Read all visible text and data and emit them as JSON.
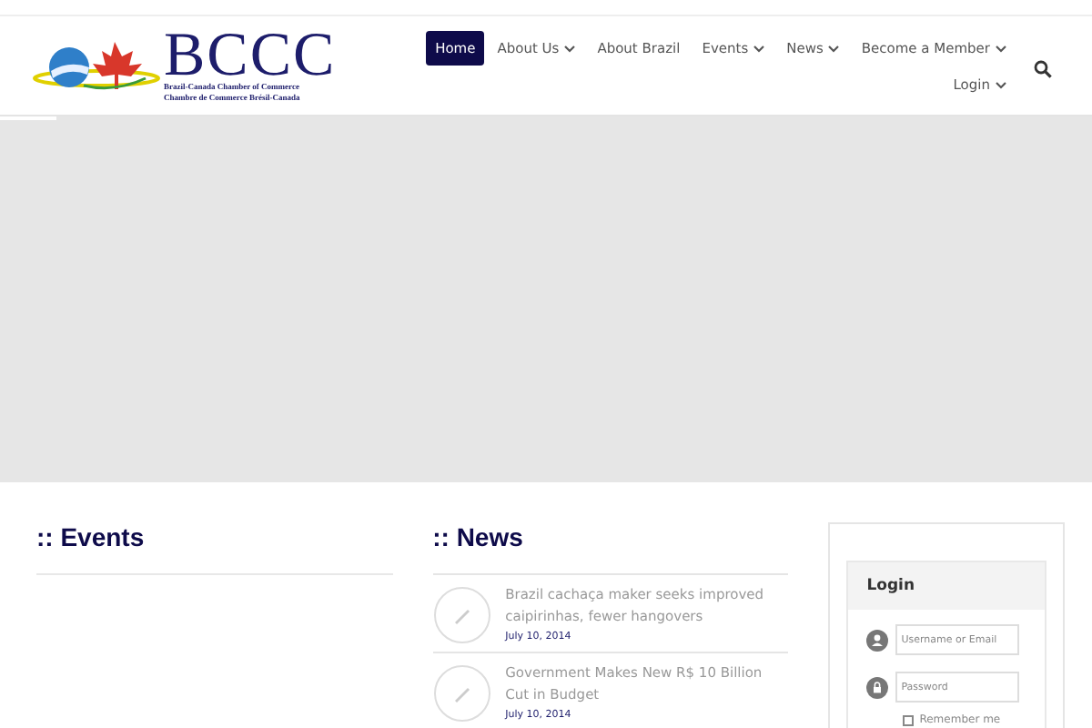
{
  "logo": {
    "acronym": "BCCC",
    "subtitle_1": "Brazil-Canada Chamber of Commerce",
    "subtitle_2": "Chambre de Commerce Brésil-Canada"
  },
  "nav": [
    {
      "label": "Home",
      "selected": true,
      "dropdown": false
    },
    {
      "label": "About Us",
      "selected": false,
      "dropdown": true
    },
    {
      "label": "About Brazil",
      "selected": false,
      "dropdown": false
    },
    {
      "label": "Events",
      "selected": false,
      "dropdown": true
    },
    {
      "label": "News",
      "selected": false,
      "dropdown": true
    },
    {
      "label": "Become a Member",
      "selected": false,
      "dropdown": true
    },
    {
      "label": "Login",
      "selected": false,
      "dropdown": true
    }
  ],
  "events": {
    "title": ":: Events"
  },
  "news": {
    "title": ":: News",
    "items": [
      {
        "title": "Brazil cachaça maker seeks improved caipirinhas, fewer hangovers",
        "date": "July 10, 2014"
      },
      {
        "title": "Government Makes New R$ 10 Billion Cut in Budget",
        "date": "July 10, 2014"
      }
    ]
  },
  "login": {
    "title": "Login",
    "username": {
      "placeholder": "Username or Email"
    },
    "password": {
      "placeholder": "Password"
    },
    "remember": {
      "label": "Remember me",
      "checked": false
    }
  }
}
